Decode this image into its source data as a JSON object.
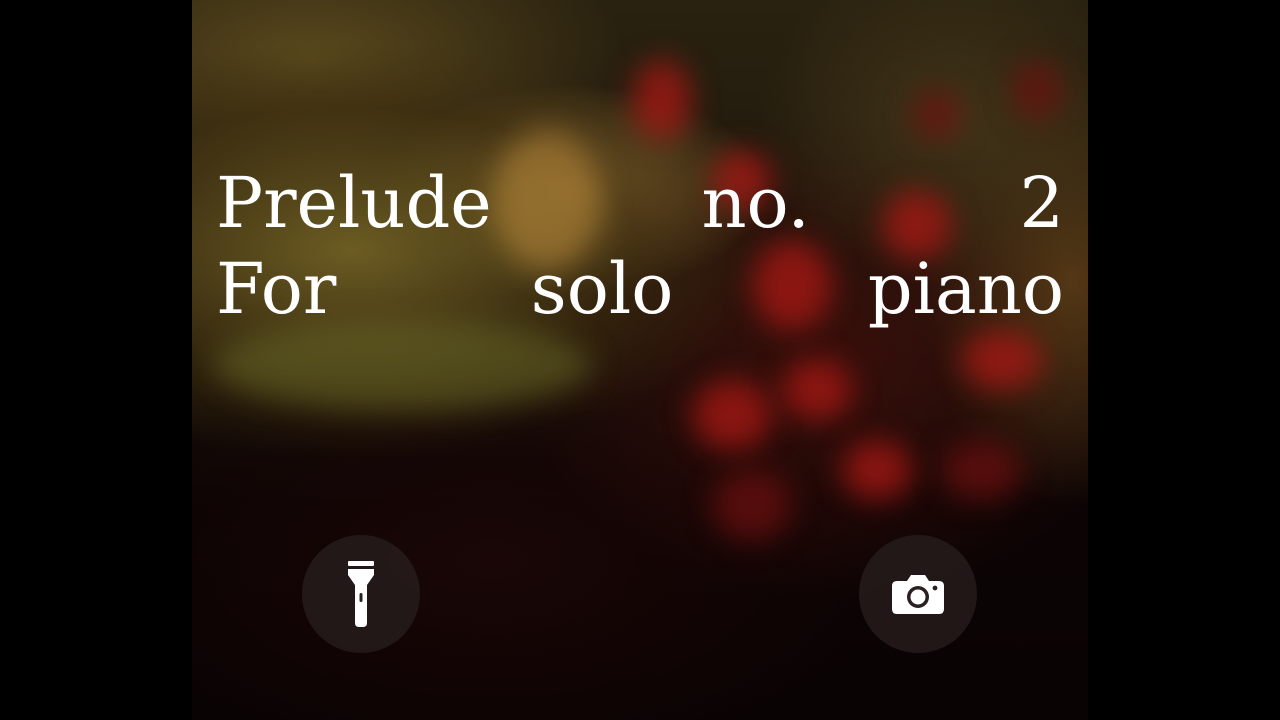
{
  "lock_screen": {
    "headline": {
      "line1": [
        "Prelude",
        "no.",
        "2"
      ],
      "line2": [
        "For",
        "solo",
        "piano"
      ]
    },
    "shortcuts": [
      {
        "name": "flashlight",
        "icon": "flashlight-icon"
      },
      {
        "name": "camera",
        "icon": "camera-icon"
      }
    ],
    "colors": {
      "text": "#ffffff",
      "button_bg": "#281e1e",
      "letterbox": "#000000"
    }
  }
}
